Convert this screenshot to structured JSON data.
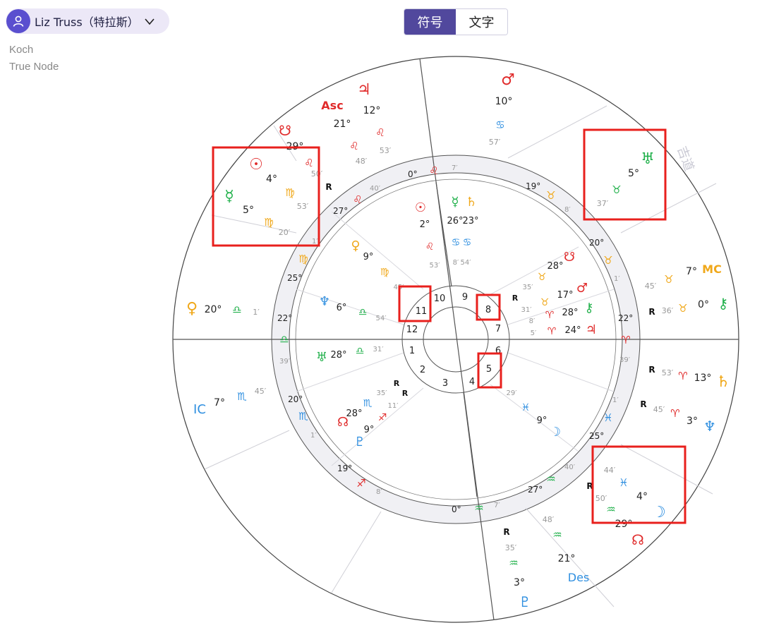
{
  "profile": {
    "name": "Liz Truss（特拉斯）"
  },
  "settings": {
    "house_system": "Koch",
    "node_type": "True Node"
  },
  "tabs": [
    {
      "label": "符号",
      "active": true
    },
    {
      "label": "文字",
      "active": false
    }
  ],
  "watermark": "吉道",
  "colors": {
    "accent": "#51489d",
    "fire": "#e02b2b",
    "earth": "#f0a81a",
    "air": "#22b14c",
    "water": "#2f8fe0",
    "highlight": "#e8201d"
  },
  "chart": {
    "house_numbers": [
      "1",
      "2",
      "3",
      "4",
      "5",
      "6",
      "7",
      "8",
      "9",
      "10",
      "11",
      "12"
    ],
    "cusp_labels": {
      "asc": "Asc",
      "mc": "MC",
      "ic": "IC",
      "des": "Des"
    },
    "outer_points": [
      {
        "glyph": "♂",
        "deg": "10°",
        "sign": "♋",
        "min": "57′"
      },
      {
        "glyph": "♅",
        "deg": "5°",
        "sign": "♉",
        "min": "37′"
      },
      {
        "glyph": "♃",
        "deg": "12°",
        "sign": "♌",
        "min": "53′"
      },
      {
        "glyph": "Asc",
        "deg": "21°",
        "sign": "♌",
        "min": "48′"
      },
      {
        "glyph": "☋",
        "deg": "29°",
        "sign": "♌",
        "min": "50′"
      },
      {
        "glyph": "☉",
        "deg": "4°",
        "sign": "♍",
        "min": "53′"
      },
      {
        "glyph": "☿",
        "deg": "5°",
        "sign": "♍",
        "min": "20′"
      },
      {
        "glyph": "♀",
        "deg": "20°",
        "sign": "♎",
        "min": "1′"
      },
      {
        "glyph": "IC",
        "deg": "7°",
        "sign": "♏",
        "min": "45′"
      },
      {
        "glyph": "MC",
        "deg": "7°",
        "sign": "♉",
        "min": "45′"
      },
      {
        "glyph": "⚷",
        "deg": "0°",
        "sign": "♉",
        "min": "36′"
      },
      {
        "glyph": "♄",
        "deg": "13°",
        "sign": "♈",
        "min": "53′"
      },
      {
        "glyph": "♆",
        "deg": "3°",
        "sign": "♈",
        "min": "45′"
      },
      {
        "glyph": "☽",
        "deg": "4°",
        "sign": "♓",
        "min": "50′"
      },
      {
        "glyph": "☊",
        "deg": "29°",
        "sign": "♒",
        "min": "44′"
      },
      {
        "glyph": "Des",
        "deg": "21°",
        "sign": "♒",
        "min": "48′"
      },
      {
        "glyph": "♇",
        "deg": "3°",
        "sign": "♒",
        "min": "35′"
      }
    ],
    "inner_points": [
      {
        "glyph": "☉",
        "deg": "2°",
        "sign": "♌",
        "min": "53′"
      },
      {
        "glyph": "☿",
        "deg": "26°",
        "sign": "♋",
        "min": "8′"
      },
      {
        "glyph": "♄",
        "deg": "23°",
        "sign": "♋",
        "min": "54′"
      },
      {
        "glyph": "♀",
        "deg": "9°",
        "sign": "♍",
        "min": "45′"
      },
      {
        "glyph": "♆",
        "deg": "6°",
        "sign": "♎",
        "min": "54′"
      },
      {
        "glyph": "♅",
        "deg": "28°",
        "sign": "♎",
        "min": "31′"
      },
      {
        "glyph": "☊",
        "deg": "28°",
        "sign": "♏",
        "min": "35′"
      },
      {
        "glyph": "♇",
        "deg": "9°",
        "sign": "♐",
        "min": "11′"
      },
      {
        "glyph": "♓",
        "deg": "9°",
        "sign": "♓",
        "min": "29′"
      },
      {
        "glyph": "☋",
        "deg": "28°",
        "sign": "♉",
        "min": "35′"
      },
      {
        "glyph": "♂",
        "deg": "17°",
        "sign": "♉",
        "min": "31′"
      },
      {
        "glyph": "⚷",
        "deg": "28°",
        "sign": "♈",
        "min": "8′"
      },
      {
        "glyph": "♃",
        "deg": "24°",
        "sign": "♈",
        "min": "5′"
      }
    ],
    "ring_degrees": [
      "0°",
      "19°",
      "20°",
      "22°",
      "20°",
      "19°",
      "0°",
      "27°",
      "25°",
      "22°",
      "25°",
      "27°"
    ],
    "ring_minutes": [
      "7′",
      "8′",
      "1′",
      "39′",
      "1′",
      "8′",
      "7′",
      "40′",
      "7′",
      "39′",
      "7′",
      "40′"
    ]
  }
}
